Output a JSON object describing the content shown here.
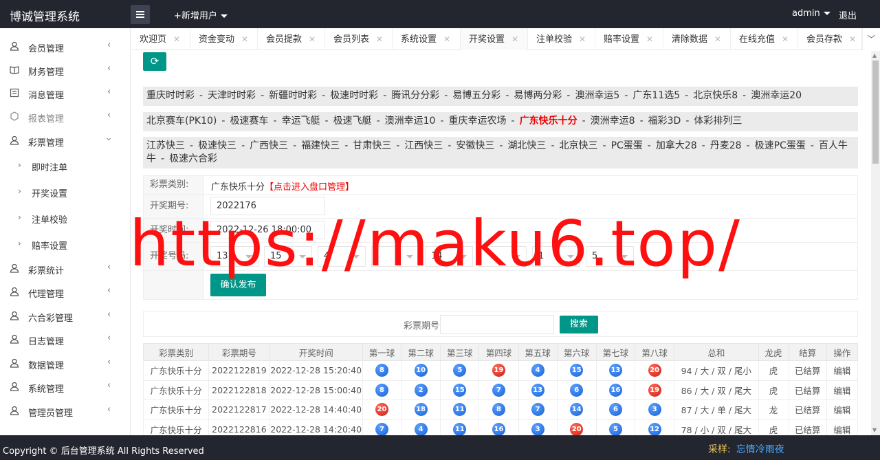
{
  "header": {
    "title": "博诚管理系统",
    "add_user": "+新增用户",
    "admin": "admin",
    "logout": "退出"
  },
  "sidebar": {
    "items": [
      {
        "label": "会员管理",
        "icon": "user-icon"
      },
      {
        "label": "财务管理",
        "icon": "book-icon"
      },
      {
        "label": "消息管理",
        "icon": "message-icon"
      },
      {
        "label": "报表管理",
        "icon": "report-icon"
      },
      {
        "label": "彩票管理",
        "icon": "user-icon"
      },
      {
        "label": "彩票统计",
        "icon": "user-icon"
      },
      {
        "label": "代理管理",
        "icon": "user-icon"
      },
      {
        "label": "六合彩管理",
        "icon": "user-icon"
      },
      {
        "label": "日志管理",
        "icon": "user-icon"
      },
      {
        "label": "数据管理",
        "icon": "user-icon"
      },
      {
        "label": "系统管理",
        "icon": "user-icon"
      },
      {
        "label": "管理员管理",
        "icon": "user-icon"
      }
    ],
    "sub_items": [
      "即时注单",
      "开奖设置",
      "注单校验",
      "赔率设置"
    ]
  },
  "tabs": [
    "欢迎页",
    "资金变动",
    "会员提款",
    "会员列表",
    "系统设置",
    "开奖设置",
    "注单校验",
    "赔率设置",
    "清除数据",
    "在线充值",
    "会员存款"
  ],
  "lottery_rows": [
    [
      "重庆时时彩",
      "天津时时彩",
      "新疆时时彩",
      "极速时时彩",
      "腾讯分分彩",
      "易博五分彩",
      "易博两分彩",
      "澳洲幸运5",
      "广东11选5",
      "北京快乐8",
      "澳洲幸运20"
    ],
    [
      "北京赛车(PK10)",
      "极速赛车",
      "幸运飞艇",
      "极速飞艇",
      "澳洲幸运10",
      "重庆幸运农场",
      "广东快乐十分",
      "澳洲幸运8",
      "福彩3D",
      "体彩排列三"
    ],
    [
      "江苏快三",
      "极速快三",
      "广西快三",
      "福建快三",
      "甘肃快三",
      "江西快三",
      "安徽快三",
      "湖北快三",
      "北京快三",
      "PC蛋蛋",
      "加拿大28",
      "丹麦28",
      "极速PC蛋蛋",
      "百人牛牛",
      "极速六合彩"
    ]
  ],
  "form": {
    "category_label": "彩票类别:",
    "category_value": "广东快乐十分",
    "category_link": "【点击进入盘口管理】",
    "period_label": "开奖期号:",
    "period_value": "2022176",
    "time_label": "开奖时间:",
    "time_value": "2022-12-26 18:00:00",
    "number_label": "开奖号码:",
    "numbers": [
      "13",
      "15",
      "4",
      "",
      "14",
      "",
      "1",
      "5"
    ],
    "submit": "确认发布"
  },
  "search": {
    "label": "彩票期号",
    "button": "搜索"
  },
  "table": {
    "headers": [
      "彩票类别",
      "彩票期号",
      "开奖时间",
      "第一球",
      "第二球",
      "第三球",
      "第四球",
      "第五球",
      "第六球",
      "第七球",
      "第八球",
      "总和",
      "龙虎",
      "结算",
      "操作"
    ],
    "rows": [
      {
        "cat": "广东快乐十分",
        "period": "2022122819",
        "time": "2022-12-28 15:20:40",
        "balls": [
          8,
          10,
          5,
          19,
          4,
          15,
          13,
          20
        ],
        "sum": "94 / 大 / 双 / 尾小",
        "lh": "虎",
        "settle": "已结算",
        "op": "编辑"
      },
      {
        "cat": "广东快乐十分",
        "period": "2022122818",
        "time": "2022-12-28 15:00:40",
        "balls": [
          8,
          2,
          15,
          7,
          13,
          6,
          16,
          19
        ],
        "sum": "86 / 大 / 双 / 尾大",
        "lh": "虎",
        "settle": "已结算",
        "op": "编辑"
      },
      {
        "cat": "广东快乐十分",
        "period": "2022122817",
        "time": "2022-12-28 14:40:40",
        "balls": [
          20,
          18,
          11,
          8,
          7,
          14,
          6,
          3
        ],
        "sum": "87 / 大 / 单 / 尾大",
        "lh": "龙",
        "settle": "已结算",
        "op": "编辑"
      },
      {
        "cat": "广东快乐十分",
        "period": "2022122816",
        "time": "2022-12-28 14:20:40",
        "balls": [
          7,
          4,
          11,
          16,
          3,
          20,
          5,
          12
        ],
        "sum": "78 / 小 / 双 / 尾大",
        "lh": "虎",
        "settle": "已结算",
        "op": "编辑"
      }
    ]
  },
  "footer": {
    "copyright": "Copyright © 后台管理系统 All Rights Reserved",
    "source_label": "采样:",
    "source_name": "忘情冷雨夜"
  },
  "watermark": "https://maku6.top/",
  "colors": {
    "primary": "#009688",
    "header_bg": "#23262e",
    "ball_blue": "#1861d6",
    "ball_red": "#cf1a10",
    "active_red": "#ee0000"
  }
}
